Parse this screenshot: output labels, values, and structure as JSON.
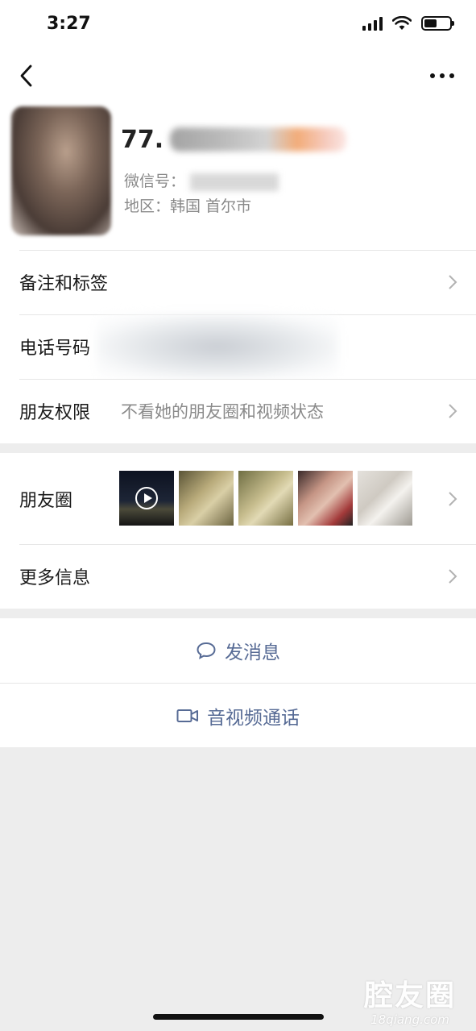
{
  "status_bar": {
    "time": "3:27",
    "battery_level": 0.5
  },
  "nav": {
    "back_icon": "chevron-left-icon",
    "more_icon": "more-dots-icon"
  },
  "profile": {
    "name": "77.",
    "wechat_id_label": "微信号：",
    "region_label": "地区：",
    "region_value": "韩国 首尔市"
  },
  "rows": {
    "remarks_label": "备注和标签",
    "phone_label": "电话号码",
    "permissions_label": "朋友权限",
    "permissions_value": "不看她的朋友圈和视频状态",
    "moments_label": "朋友圈",
    "more_info_label": "更多信息"
  },
  "actions": {
    "message_label": "发消息",
    "message_icon": "chat-bubble-icon",
    "call_label": "音视频通话",
    "call_icon": "video-camera-icon"
  },
  "colors": {
    "link_blue": "#576b95",
    "background": "#ededed"
  },
  "watermark": {
    "main": "腔友圈",
    "sub": "18qiang.com"
  }
}
